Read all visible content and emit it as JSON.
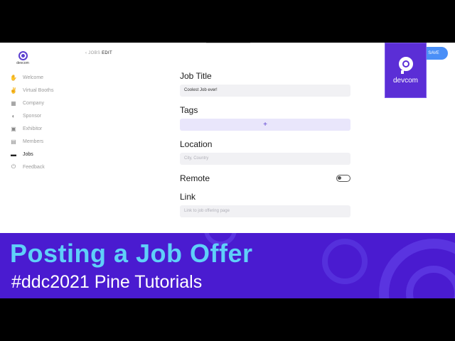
{
  "app": {
    "logo_text": "devcom",
    "breadcrumb": {
      "parent": "‹ JOBS",
      "current": " EDIT"
    },
    "save_label": "SAVE"
  },
  "sidebar": {
    "items": [
      {
        "label": "Welcome",
        "icon": "hand-icon"
      },
      {
        "label": "Virtual Booths",
        "icon": "booth-icon"
      },
      {
        "label": "Company",
        "icon": "building-icon"
      },
      {
        "label": "Sponsor",
        "icon": "sponsor-icon"
      },
      {
        "label": "Exhibitor",
        "icon": "camera-icon"
      },
      {
        "label": "Members",
        "icon": "members-icon"
      },
      {
        "label": "Jobs",
        "icon": "briefcase-icon",
        "active": true
      },
      {
        "label": "Feedback",
        "icon": "power-icon"
      }
    ]
  },
  "form": {
    "job_title": {
      "label": "Job Title",
      "value": "Coolest Job ever!"
    },
    "tags": {
      "label": "Tags",
      "add_symbol": "+"
    },
    "location": {
      "label": "Location",
      "placeholder": "City, Country"
    },
    "remote": {
      "label": "Remote"
    },
    "link": {
      "label": "Link",
      "placeholder": "Link to job offering page"
    }
  },
  "badge": {
    "text": "devcom"
  },
  "banner": {
    "title": "Posting a Job Offer",
    "subtitle": "#ddc2021 Pine Tutorials"
  },
  "colors": {
    "brand_purple": "#5b2ed6",
    "banner_bg": "#4a1bd0",
    "title_cyan": "#5fd0f8",
    "save_blue": "#4a8ff7"
  }
}
